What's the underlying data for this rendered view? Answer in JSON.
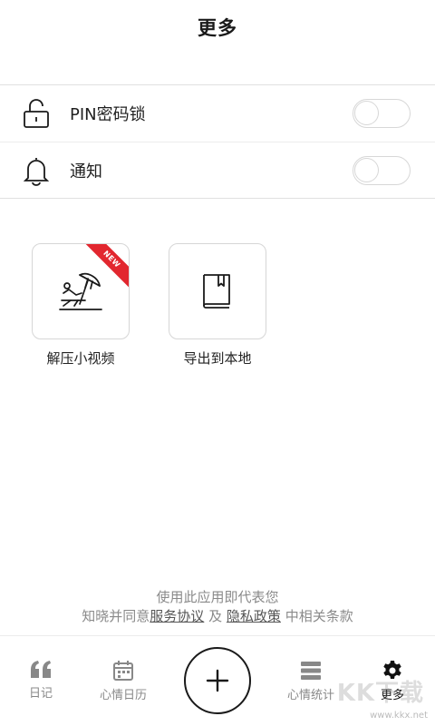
{
  "header": {
    "title": "更多"
  },
  "settings": {
    "items": [
      {
        "label": "PIN密码锁",
        "icon": "unlock-icon",
        "enabled": false
      },
      {
        "label": "通知",
        "icon": "bell-icon",
        "enabled": false
      }
    ]
  },
  "tiles": [
    {
      "label": "解压小视频",
      "icon": "beach-umbrella-icon",
      "badge": "NEW"
    },
    {
      "label": "导出到本地",
      "icon": "book-icon"
    }
  ],
  "agreement": {
    "line1": "使用此应用即代表您",
    "line2_prefix": "知晓并同意",
    "terms_link": "服务协议",
    "and": "及",
    "privacy_link": "隐私政策",
    "line2_suffix": "中相关条款"
  },
  "tabbar": {
    "tabs": [
      {
        "label": "日记",
        "icon": "quote-icon"
      },
      {
        "label": "心情日历",
        "icon": "calendar-icon"
      },
      {
        "label": "心情统计",
        "icon": "stack-icon"
      },
      {
        "label": "更多",
        "icon": "gear-icon",
        "active": true
      }
    ],
    "fab_icon": "plus-icon"
  },
  "watermark": {
    "logo": "KK下载",
    "url": "www.kkx.net"
  },
  "colors": {
    "badge": "#e2272f",
    "text": "#1a1a1a",
    "muted": "#8a8a8a",
    "border": "#d6d6d6"
  }
}
